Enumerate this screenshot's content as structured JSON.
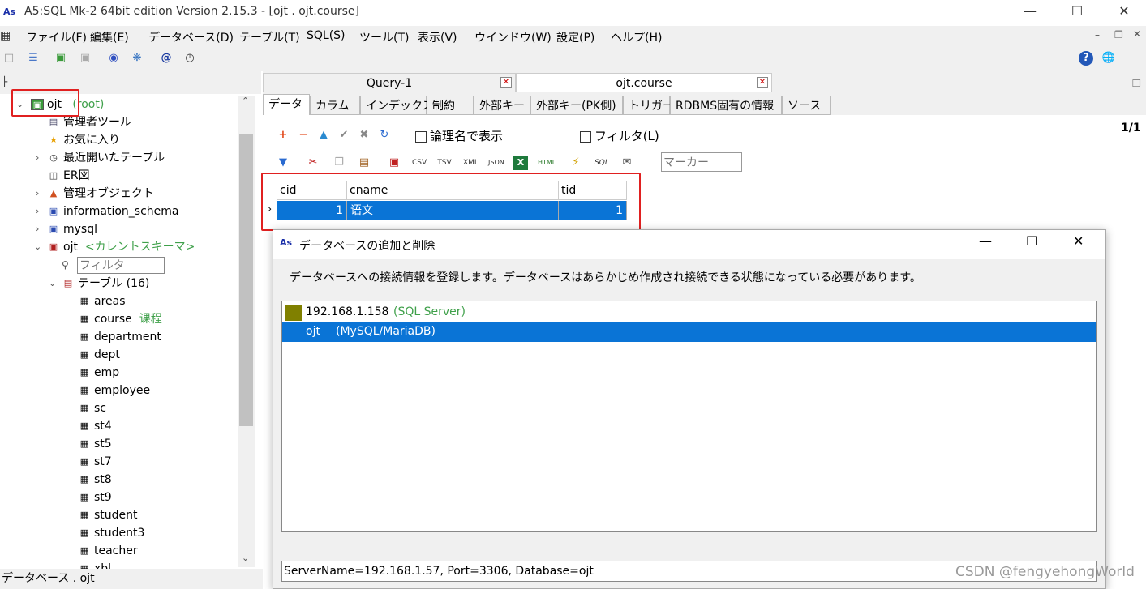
{
  "window": {
    "title": "A5:SQL Mk-2 64bit edition Version 2.15.3 - [ojt . ojt.course]",
    "app_icon": "As"
  },
  "menu": [
    "ファイル(F)",
    "編集(E)",
    "データベース(D)",
    "テーブル(T)",
    "SQL(S)",
    "ツール(T)",
    "表示(V)",
    "ウインドウ(W)",
    "設定(P)",
    "ヘルプ(H)"
  ],
  "tree": {
    "root": {
      "label": "ojt",
      "note": "(root)"
    },
    "items": [
      {
        "label": "管理者ツール",
        "icon": "admin-tools-icon"
      },
      {
        "label": "お気に入り",
        "icon": "star-icon"
      },
      {
        "label": "最近開いたテーブル",
        "icon": "clock-icon"
      },
      {
        "label": "ER図",
        "icon": "er-diagram-icon"
      },
      {
        "label": "管理オブジェクト",
        "icon": "objects-icon"
      },
      {
        "label": "information_schema",
        "icon": "schema-icon"
      },
      {
        "label": "mysql",
        "icon": "schema-icon"
      }
    ],
    "schema": {
      "label": "ojt",
      "note": "<カレントスキーマ>"
    },
    "filter_placeholder": "フィルタ",
    "tables_label": "テーブル (16)",
    "tables": [
      {
        "name": "areas",
        "comment": ""
      },
      {
        "name": "course",
        "comment": "课程"
      },
      {
        "name": "department",
        "comment": ""
      },
      {
        "name": "dept",
        "comment": ""
      },
      {
        "name": "emp",
        "comment": ""
      },
      {
        "name": "employee",
        "comment": ""
      },
      {
        "name": "sc",
        "comment": ""
      },
      {
        "name": "st4",
        "comment": ""
      },
      {
        "name": "st5",
        "comment": ""
      },
      {
        "name": "st7",
        "comment": ""
      },
      {
        "name": "st8",
        "comment": ""
      },
      {
        "name": "st9",
        "comment": ""
      },
      {
        "name": "student",
        "comment": ""
      },
      {
        "name": "student3",
        "comment": ""
      },
      {
        "name": "teacher",
        "comment": ""
      },
      {
        "name": "xbl",
        "comment": ""
      }
    ]
  },
  "status_bar": "データベース . ojt",
  "doc_tabs": [
    {
      "label": "Query-1",
      "close": "✕"
    },
    {
      "label": "ojt.course",
      "close": "✕"
    }
  ],
  "sub_tabs": [
    "データ",
    "カラム",
    "インデックス",
    "制約",
    "外部キー",
    "外部キー(PK側)",
    "トリガー",
    "RDBMS固有の情報",
    "ソース"
  ],
  "data_toolbar": {
    "logical_name_label": "論理名で表示",
    "filter_label": "フィルタ(L)",
    "page_indicator": "1/1",
    "marker_placeholder": "マーカー"
  },
  "grid": {
    "columns": [
      "cid",
      "cname",
      "tid"
    ],
    "rows": [
      [
        "1",
        "语文",
        "1"
      ]
    ]
  },
  "dialog": {
    "title": "データベースの追加と削除",
    "description": "データベースへの接続情報を登録します。データベースはあらかじめ作成され接続できる状態になっている必要があります。",
    "databases": [
      {
        "name": "192.168.1.158",
        "type": "(SQL Server)"
      },
      {
        "name": "ojt",
        "type": "(MySQL/MariaDB)"
      }
    ],
    "info": "ServerName=192.168.1.57, Port=3306, Database=ojt"
  },
  "watermark": "CSDN @fengyehongWorld"
}
